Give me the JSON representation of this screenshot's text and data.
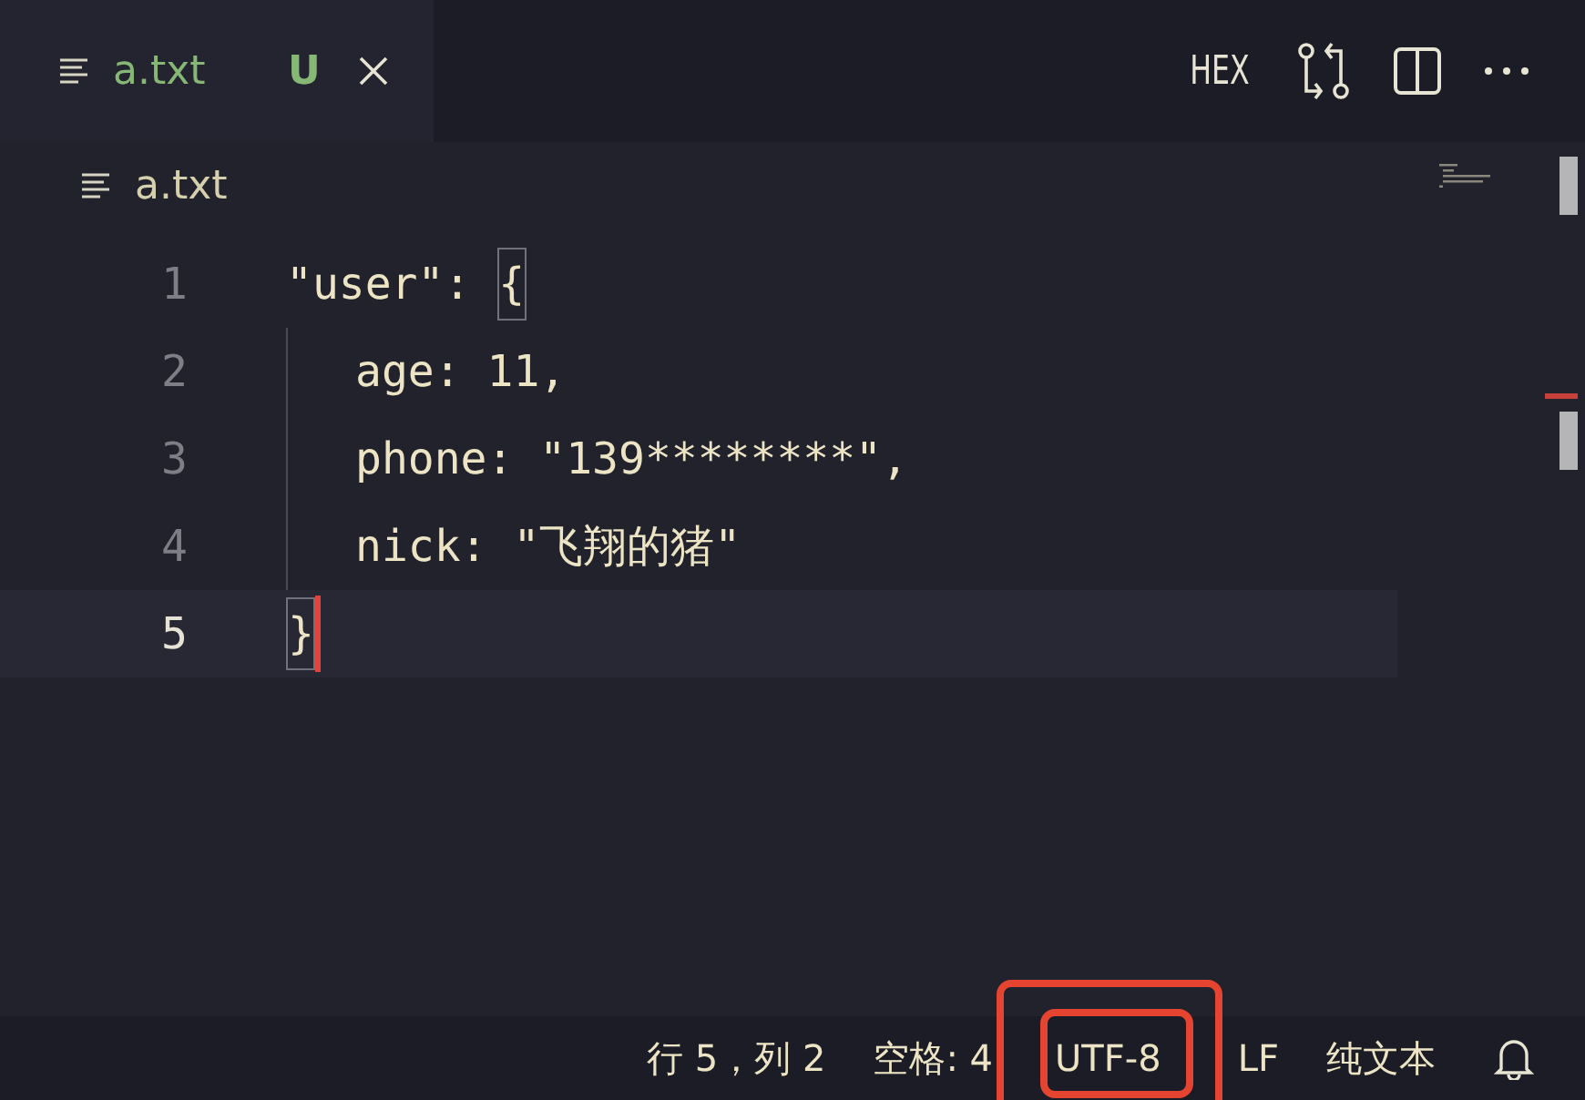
{
  "tab": {
    "label": "a.txt",
    "status": "U"
  },
  "toolbar": {
    "hex_label": "HEX"
  },
  "breadcrumb": "a.txt",
  "lines": [
    {
      "number": "1",
      "text": "\"user\": ",
      "bracket": "{",
      "current": false,
      "children": [
        {
          "number": "2",
          "text": "age: 11,",
          "current": false
        },
        {
          "number": "3",
          "text": "phone: \"139********\",",
          "current": false
        },
        {
          "number": "4",
          "text": "nick: \"飞翔的猪\"",
          "current": false
        }
      ]
    },
    {
      "number": "5",
      "bracket": "}",
      "current": true
    }
  ],
  "status_bar": [
    "行 5，列 2",
    "空格: 4",
    "UTF-8",
    "LF",
    "纯文本"
  ]
}
